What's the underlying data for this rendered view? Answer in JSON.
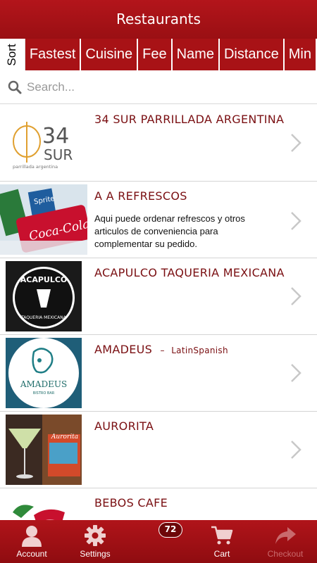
{
  "header": {
    "title": "Restaurants"
  },
  "sort": {
    "label": "Sort",
    "options": [
      "Fastest",
      "Cuisine",
      "Fee",
      "Name",
      "Distance",
      "Min"
    ]
  },
  "search": {
    "placeholder": "Search...",
    "icon": "search-icon"
  },
  "restaurants": [
    {
      "name": "34 SUR PARRILLADA ARGENTINA",
      "cuisine": "",
      "description": "",
      "logo_text": "34",
      "logo_sub": "SUR",
      "logo_tagline": "parrillada argentina"
    },
    {
      "name": "A A REFRESCOS",
      "cuisine": "",
      "description": "Aqui puede ordenar refrescos y otros articulos de conveniencia para complementar su pedido.",
      "logo_text": "Coca-Cola",
      "logo_sub": "Sprite"
    },
    {
      "name": "ACAPULCO TAQUERIA MEXICANA",
      "cuisine": "",
      "description": "",
      "logo_text": "ACAPULCO",
      "logo_sub": "TAQUERIA MEXICANA"
    },
    {
      "name": "AMADEUS",
      "cuisine": "LatinSpanish",
      "description": "",
      "logo_text": "AMADEUS",
      "logo_sub": "BISTRO BAR"
    },
    {
      "name": "AURORITA",
      "cuisine": "",
      "description": "",
      "logo_text": "Aurorita"
    },
    {
      "name": "BEBOS CAFE",
      "cuisine": "",
      "description": ""
    }
  ],
  "tabs": [
    {
      "label": "Account",
      "icon": "user-icon"
    },
    {
      "label": "Settings",
      "icon": "gear-icon"
    },
    {
      "label": "",
      "icon": ""
    },
    {
      "label": "Cart",
      "icon": "cart-icon",
      "badge": "72"
    },
    {
      "label": "Checkout",
      "icon": "forward-arrow-icon"
    }
  ],
  "colors": {
    "primary": "#a81216",
    "text_accent": "#7a0f12"
  }
}
